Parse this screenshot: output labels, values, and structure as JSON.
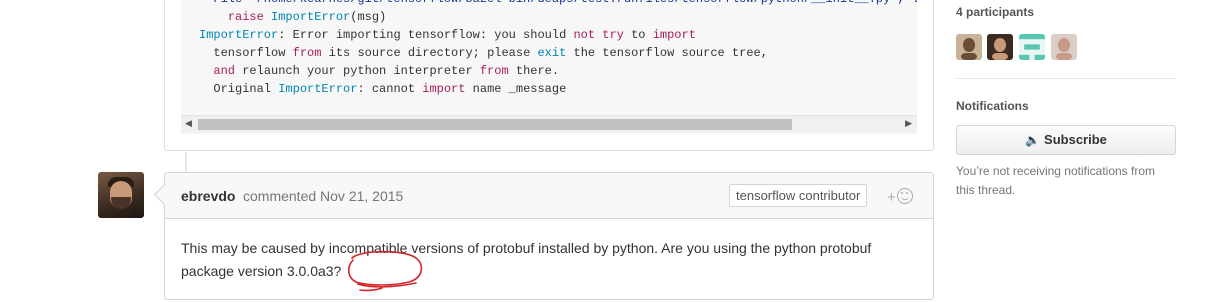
{
  "code_block": {
    "lines": [
      [
        {
          "t": "  File \"/home/kearnes/git/tensorflow/bazel-bin/deaps/test.runfiles/tensorflow/python/__init__.py\", line",
          "c": "s"
        }
      ],
      [
        {
          "t": "    ",
          "c": ""
        },
        {
          "t": "raise",
          "c": "k"
        },
        {
          "t": " ",
          "c": ""
        },
        {
          "t": "ImportError",
          "c": "c"
        },
        {
          "t": "(msg)",
          "c": ""
        }
      ],
      [
        {
          "t": "ImportError",
          "c": "c"
        },
        {
          "t": ": Error importing tensorflow: you should ",
          "c": ""
        },
        {
          "t": "not",
          "c": "k"
        },
        {
          "t": " ",
          "c": ""
        },
        {
          "t": "try",
          "c": "k"
        },
        {
          "t": " to ",
          "c": ""
        },
        {
          "t": "import",
          "c": "k"
        }
      ],
      [
        {
          "t": "  tensorflow ",
          "c": ""
        },
        {
          "t": "from",
          "c": "k"
        },
        {
          "t": " its source directory; please ",
          "c": ""
        },
        {
          "t": "exit",
          "c": "c"
        },
        {
          "t": " the tensorflow source tree,",
          "c": ""
        }
      ],
      [
        {
          "t": "  ",
          "c": ""
        },
        {
          "t": "and",
          "c": "k"
        },
        {
          "t": " relaunch your python interpreter ",
          "c": ""
        },
        {
          "t": "from",
          "c": "k"
        },
        {
          "t": " there.",
          "c": ""
        }
      ],
      [
        {
          "t": "  Original ",
          "c": ""
        },
        {
          "t": "ImportError",
          "c": "c"
        },
        {
          "t": ": cannot ",
          "c": ""
        },
        {
          "t": "import",
          "c": "k"
        },
        {
          "t": " name _message",
          "c": ""
        }
      ]
    ],
    "scroll_left_arrow": "◀",
    "scroll_right_arrow": "▶"
  },
  "comment": {
    "author": "ebrevdo",
    "action": "commented Nov 21, 2015",
    "badge": "tensorflow contributor",
    "reaction_plus": "+",
    "body": "This may be caused by incompatible versions of protobuf installed by python. Are you using the python protobuf package version 3.0.0a3?"
  },
  "sidebar": {
    "participants_title": "4 participants",
    "participants": [
      {
        "icon": "avatar-1",
        "bg": "#c8b29a",
        "fg": "#6b4c36"
      },
      {
        "icon": "avatar-2",
        "bg": "#3a2a20",
        "fg": "#c99a7a"
      },
      {
        "icon": "identicon",
        "bg": "#e9f6f3",
        "fg": "#56c6b0"
      },
      {
        "icon": "avatar-4",
        "bg": "#d9cfc6",
        "fg": "#c89a86"
      }
    ],
    "notifications_title": "Notifications",
    "subscribe_icon": "🔈",
    "subscribe_label": "Subscribe",
    "notification_text": "You’re not receiving notifications from this thread."
  },
  "colors": {
    "annotation": "#d0262a",
    "keyword": "#a71d5d",
    "constant": "#0086b3"
  }
}
